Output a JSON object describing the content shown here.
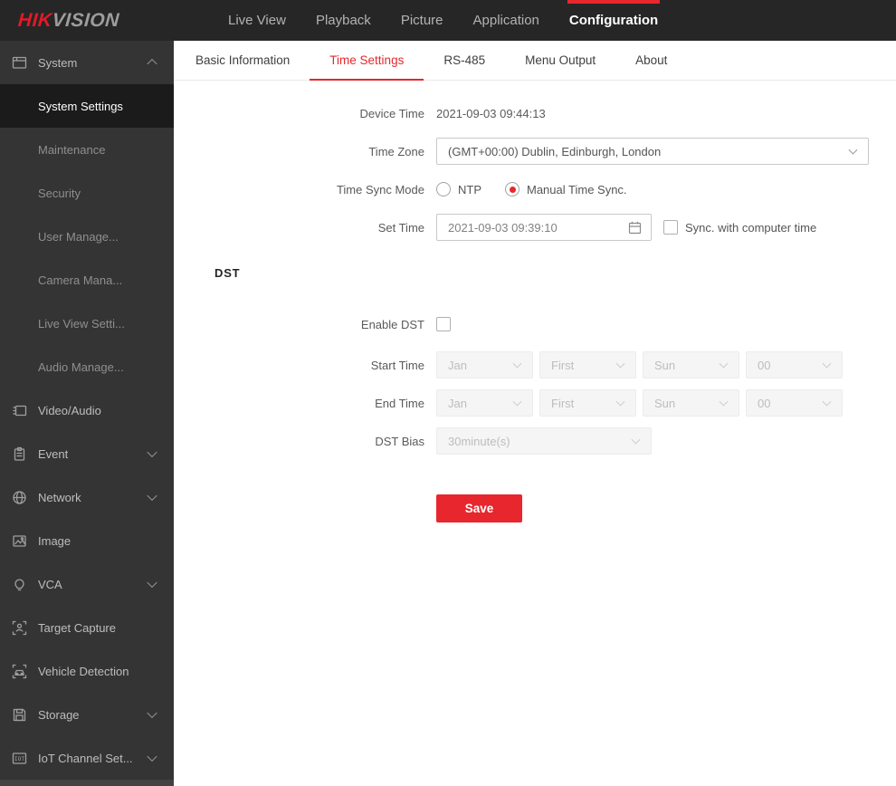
{
  "topbar": {
    "logo_hik": "HIK",
    "logo_vision": "VISION",
    "nav": [
      {
        "label": "Live View",
        "active": false
      },
      {
        "label": "Playback",
        "active": false
      },
      {
        "label": "Picture",
        "active": false
      },
      {
        "label": "Application",
        "active": false
      },
      {
        "label": "Configuration",
        "active": true
      }
    ]
  },
  "sidebar": {
    "items": [
      {
        "label": "System",
        "type": "group",
        "icon": "system-icon",
        "chevron": "up",
        "expanded": true
      },
      {
        "label": "System Settings",
        "type": "sub",
        "active": true
      },
      {
        "label": "Maintenance",
        "type": "sub",
        "active": false
      },
      {
        "label": "Security",
        "type": "sub",
        "active": false
      },
      {
        "label": "User Manage...",
        "type": "sub",
        "active": false
      },
      {
        "label": "Camera Mana...",
        "type": "sub",
        "active": false
      },
      {
        "label": "Live View Setti...",
        "type": "sub",
        "active": false
      },
      {
        "label": "Audio Manage...",
        "type": "sub",
        "active": false
      },
      {
        "label": "Video/Audio",
        "type": "group",
        "icon": "video-audio-icon",
        "chevron": "none"
      },
      {
        "label": "Event",
        "type": "group",
        "icon": "event-icon",
        "chevron": "down"
      },
      {
        "label": "Network",
        "type": "group",
        "icon": "network-icon",
        "chevron": "down"
      },
      {
        "label": "Image",
        "type": "group",
        "icon": "image-icon",
        "chevron": "none"
      },
      {
        "label": "VCA",
        "type": "group",
        "icon": "vca-icon",
        "chevron": "down"
      },
      {
        "label": "Target Capture",
        "type": "group",
        "icon": "target-capture-icon",
        "chevron": "none"
      },
      {
        "label": "Vehicle Detection",
        "type": "group",
        "icon": "vehicle-detection-icon",
        "chevron": "none"
      },
      {
        "label": "Storage",
        "type": "group",
        "icon": "storage-icon",
        "chevron": "down"
      },
      {
        "label": "IoT Channel Set...",
        "type": "group",
        "icon": "iot-channel-icon",
        "chevron": "down"
      }
    ]
  },
  "tabs": [
    {
      "label": "Basic Information",
      "active": false
    },
    {
      "label": "Time Settings",
      "active": true
    },
    {
      "label": "RS-485",
      "active": false
    },
    {
      "label": "Menu Output",
      "active": false
    },
    {
      "label": "About",
      "active": false
    }
  ],
  "form": {
    "device_time": {
      "label": "Device Time",
      "value": "2021-09-03 09:44:13"
    },
    "time_zone": {
      "label": "Time Zone",
      "value": "(GMT+00:00) Dublin, Edinburgh, London"
    },
    "time_sync_mode": {
      "label": "Time Sync Mode",
      "options": [
        {
          "label": "NTP",
          "selected": false
        },
        {
          "label": "Manual Time Sync.",
          "selected": true
        }
      ]
    },
    "set_time": {
      "label": "Set Time",
      "value": "2021-09-03 09:39:10",
      "sync_checkbox_label": "Sync. with computer time",
      "sync_checked": false
    },
    "dst_section_title": "DST",
    "enable_dst": {
      "label": "Enable DST",
      "checked": false
    },
    "start_time": {
      "label": "Start Time",
      "month": "Jan",
      "week": "First",
      "day": "Sun",
      "hour": "00",
      "disabled": true
    },
    "end_time": {
      "label": "End Time",
      "month": "Jan",
      "week": "First",
      "day": "Sun",
      "hour": "00",
      "disabled": true
    },
    "dst_bias": {
      "label": "DST Bias",
      "value": "30minute(s)",
      "disabled": true
    },
    "save_label": "Save"
  },
  "colors": {
    "accent_red": "#e7272d",
    "logo_red": "#e01a28",
    "topbar_bg": "#262626",
    "sidebar_bg": "#343434",
    "sidebar_active_bg": "#1b1b1b",
    "disabled_field_bg": "#f5f5f5"
  }
}
